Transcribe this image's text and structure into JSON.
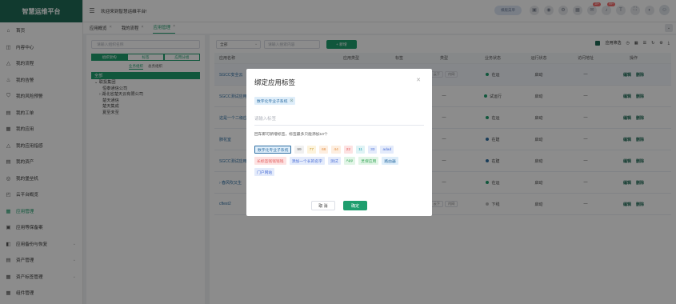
{
  "brand": "智慧运维平台",
  "header": {
    "welcome": "欢迎来到智慧运维平台!",
    "pill": "横版菜单",
    "badge1": "10+",
    "badge2": "99+"
  },
  "tabs": [
    {
      "label": "应用概览"
    },
    {
      "label": "我的流程"
    },
    {
      "label": "应用管理"
    }
  ],
  "menu": [
    {
      "label": "首页",
      "icon": "⌂"
    },
    {
      "label": "内容中心",
      "icon": "◫"
    },
    {
      "label": "我的流程",
      "icon": "△"
    },
    {
      "label": "我的告警",
      "icon": "♨"
    },
    {
      "label": "我的风险预警",
      "icon": "⛉"
    },
    {
      "label": "我的工单",
      "icon": "▤"
    },
    {
      "label": "我的应用",
      "icon": "▦"
    },
    {
      "label": "我的应用指感",
      "icon": "△"
    },
    {
      "label": "我的资产",
      "icon": "▤"
    },
    {
      "label": "我的堡垒机",
      "icon": "◎"
    },
    {
      "label": "云平台概览",
      "icon": "◰"
    },
    {
      "label": "应用管理",
      "icon": "▦"
    },
    {
      "label": "应用等保备案",
      "icon": "▣"
    },
    {
      "label": "应用备份与恢复",
      "icon": "◧"
    },
    {
      "label": "资产管理",
      "icon": "▤"
    },
    {
      "label": "资产标签管理",
      "icon": "▦"
    },
    {
      "label": "组件管理",
      "icon": "▦"
    }
  ],
  "left_panel": {
    "search_placeholder": "请输入组织名称",
    "seg": [
      "组织架构",
      "标签",
      "应用分组"
    ],
    "subseg": [
      "业务组织",
      "总务组织"
    ],
    "tree": [
      "全部",
      "联投集团",
      "恒泰通信公司",
      "湖北省楚天云有限公司",
      "楚天通信",
      "楚天集成",
      "夏至未至"
    ]
  },
  "filters": {
    "select": "全部",
    "search_placeholder": "请输入搜索内容",
    "add": "+ 新增",
    "show_filter": "应用筛选"
  },
  "table": {
    "headers": [
      "应用名称",
      "应用类型",
      "标签",
      "类型",
      "业务状态",
      "运行状态",
      "访问地址",
      "操作"
    ],
    "rows": [
      {
        "name": "SGCC安全云",
        "app_type": "",
        "type_tags": [
          "云下",
          "内网"
        ],
        "status": "在运",
        "status_color": "#1f9e6e",
        "run": "启动",
        "addr": "—"
      },
      {
        "name": "SGCC测试应用",
        "app_type": "",
        "type_tags": [],
        "status": "试运行",
        "status_color": "#1f9e6e",
        "run": "启动",
        "addr": "—"
      },
      {
        "name": "这是一个二级应用",
        "app_type": "",
        "type_tags": [],
        "status": "在运",
        "status_color": "#1f9e6e",
        "run": "启动",
        "addr": "—"
      },
      {
        "name": "肺花室",
        "app_type": "",
        "type_tags": [],
        "status": "在建",
        "status_color": "#2f6fa3",
        "run": "启动",
        "addr": "—"
      },
      {
        "name": "SGCC测试应用",
        "app_type": "",
        "type_tags": [],
        "status": "在建",
        "status_color": "#2f6fa3",
        "run": "启动",
        "addr": "—"
      },
      {
        "name": "› 春风吹又生",
        "app_type": "—",
        "type_tags": [],
        "status": "在运",
        "status_color": "#1f9e6e",
        "run": "启动",
        "addr": "—"
      },
      {
        "name": "cftest2",
        "app_type": "数字化支撑系统",
        "type_tags": [
          "云下",
          "内网"
        ],
        "status": "下线",
        "status_color": "#bbb",
        "run": "启动",
        "addr": "—"
      }
    ],
    "edit": "编辑",
    "del": "删除"
  },
  "modal": {
    "title": "绑定应用标签",
    "selected": "数字化专业子系统",
    "input_placeholder": "请输入标签",
    "hint": "回车即可新增标签，标签最多只能添加10个",
    "tags": [
      {
        "label": "数字化专业子系统",
        "bg": "#dfeefa",
        "fg": "#2f6fa3",
        "border": "#2f6fa3"
      },
      {
        "label": "99",
        "bg": "#f0f0f0",
        "fg": "#666"
      },
      {
        "label": "77",
        "bg": "#fdf3dc",
        "fg": "#c69a2b"
      },
      {
        "label": "66",
        "bg": "#fdeee0",
        "fg": "#e28a3a"
      },
      {
        "label": "44",
        "bg": "#fdeee0",
        "fg": "#e28a3a"
      },
      {
        "label": "22",
        "bg": "#fde2e2",
        "fg": "#e05b5b"
      },
      {
        "label": "11",
        "bg": "#dff3f5",
        "fg": "#2aa5b5"
      },
      {
        "label": "33",
        "bg": "#e4ebfb",
        "fg": "#4b6fd6"
      },
      {
        "label": "adad",
        "bg": "#e4ebfb",
        "fg": "#4b6fd6"
      },
      {
        "label": "长标签钱钱钱钱",
        "bg": "#fde2e2",
        "fg": "#e05b5b"
      },
      {
        "label": "添加一个长的名字",
        "bg": "#e4ebfb",
        "fg": "#4b6fd6"
      },
      {
        "label": "测试",
        "bg": "#e4ebfb",
        "fg": "#4b6fd6"
      },
      {
        "label": "App",
        "bg": "#e2f5e7",
        "fg": "#3aa85a"
      },
      {
        "label": "灵保应用",
        "bg": "#e2f5e7",
        "fg": "#3aa85a"
      },
      {
        "label": "路由器",
        "bg": "#dfeefa",
        "fg": "#2f6fa3"
      },
      {
        "label": "门户网站",
        "bg": "#e4ebfb",
        "fg": "#4b6fd6"
      }
    ],
    "cancel": "取 消",
    "confirm": "确定"
  }
}
